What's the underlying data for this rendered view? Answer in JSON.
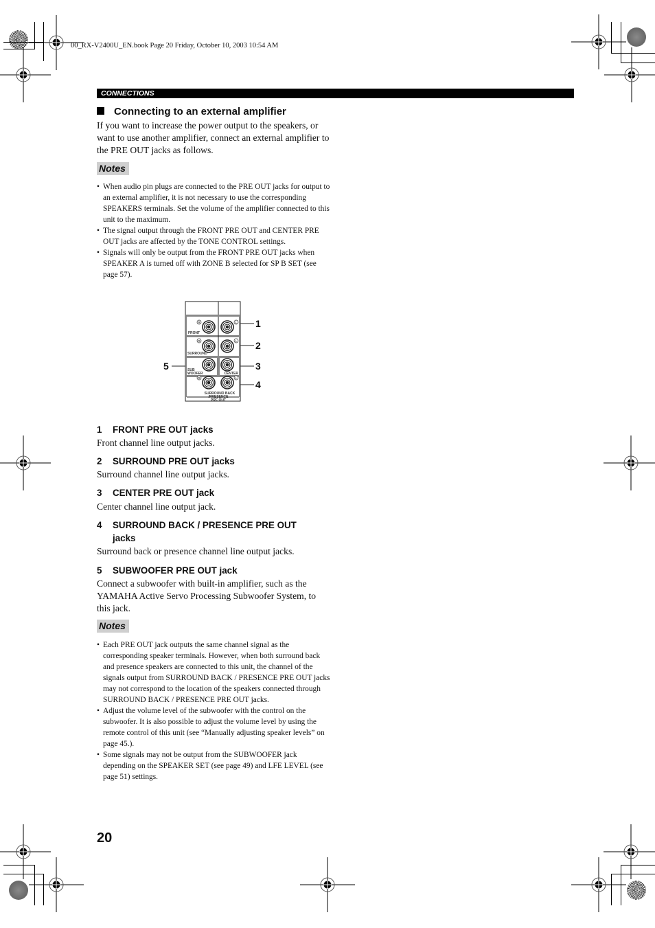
{
  "print_header": {
    "book_info": "00_RX-V2400U_EN.book  Page 20  Friday, October 10, 2003  10:54 AM"
  },
  "section_label": "CONNECTIONS",
  "heading": "Connecting to an external amplifier",
  "intro": "If you want to increase the power output to the speakers, or want to use another amplifier, connect an external amplifier to the PRE OUT jacks as follows.",
  "notes_label": "Notes",
  "notes_1": [
    "When audio pin plugs are connected to the PRE OUT jacks for output to an external amplifier, it is not necessary to use the corresponding SPEAKERS terminals. Set the volume of the amplifier connected to this unit to the maximum.",
    "The signal output through the FRONT PRE OUT and CENTER PRE OUT jacks are affected by the TONE CONTROL settings.",
    "Signals will only be output from the FRONT PRE OUT jacks when SPEAKER A is turned off with ZONE B selected for SP B SET (see page 57)."
  ],
  "diagram": {
    "panel_labels": {
      "front": "FRONT",
      "surround": "SURROUND",
      "subwoofer_line1": "SUB",
      "subwoofer_line2": "WOOFER",
      "center": "CENTER",
      "surround_back_line1": "SURROUND BACK",
      "surround_back_line2": "/PRESENCE",
      "pre_out": "PRE OUT"
    },
    "channel_marks": {
      "right": "R",
      "left": "L"
    },
    "callouts": [
      "1",
      "2",
      "3",
      "4",
      "5"
    ]
  },
  "items": [
    {
      "num": "1",
      "title": "FRONT PRE OUT jacks",
      "desc": "Front channel line output jacks."
    },
    {
      "num": "2",
      "title": "SURROUND PRE OUT jacks",
      "desc": "Surround channel line output jacks."
    },
    {
      "num": "3",
      "title": "CENTER PRE OUT jack",
      "desc": "Center channel line output jack."
    },
    {
      "num": "4",
      "title_line1": "SURROUND BACK / PRESENCE PRE OUT",
      "title_line2": "jacks",
      "desc": "Surround back or presence channel line output jacks."
    },
    {
      "num": "5",
      "title": "SUBWOOFER PRE OUT jack",
      "desc": "Connect a subwoofer with built-in amplifier, such as the YAMAHA Active Servo Processing Subwoofer System, to this jack."
    }
  ],
  "notes_2": [
    "Each PRE OUT jack outputs the same channel signal as the corresponding speaker terminals. However, when both surround back and presence speakers are connected to this unit, the channel of the signals output from SURROUND BACK / PRESENCE PRE OUT jacks may not correspond to the location of the speakers connected through SURROUND BACK / PRESENCE PRE OUT jacks.",
    "Adjust the volume level of the subwoofer with the control on the subwoofer. It is also possible to adjust the volume level by using the remote control of this unit (see “Manually adjusting speaker levels” on page 45.).",
    "Some signals may not be output from the SUBWOOFER jack depending on the SPEAKER SET (see page 49) and LFE LEVEL (see page 51) settings."
  ],
  "bullet_char": "•",
  "page_number": "20"
}
